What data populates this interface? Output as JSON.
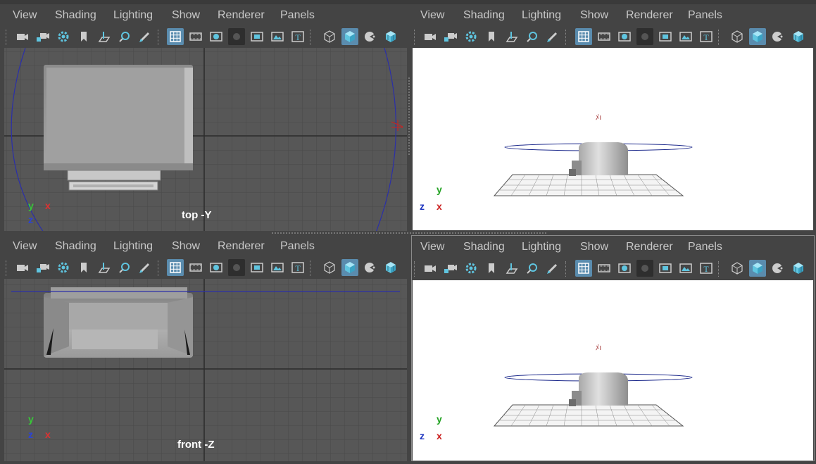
{
  "menu": {
    "view": "View",
    "shading": "Shading",
    "lighting": "Lighting",
    "show": "Show",
    "renderer": "Renderer",
    "panels": "Panels"
  },
  "viewports": {
    "top": {
      "label": "top -Y"
    },
    "front": {
      "label": "front -Z"
    }
  },
  "axes": {
    "x": "x",
    "y": "y",
    "z": "z"
  },
  "colors": {
    "panel_bg": "#444444",
    "ortho_bg": "#575757",
    "persp_bg": "#ffffff",
    "active_button": "#5a8cae",
    "axis_x": "#e03131",
    "axis_y": "#37c837",
    "axis_z": "#2b43d8"
  },
  "toolbar_icons": [
    "camera-icon",
    "camera-lock-icon",
    "camera-settings-icon",
    "bookmark-icon",
    "image-plane-icon",
    "pan-zoom-icon",
    "grease-pencil-icon",
    "grid-icon",
    "film-gate-icon",
    "resolution-gate-icon",
    "gate-mask-icon",
    "field-chart-icon",
    "safe-action-icon",
    "safe-title-icon",
    "wireframe-icon",
    "smooth-shade-icon",
    "default-lighting-icon",
    "textured-icon"
  ]
}
